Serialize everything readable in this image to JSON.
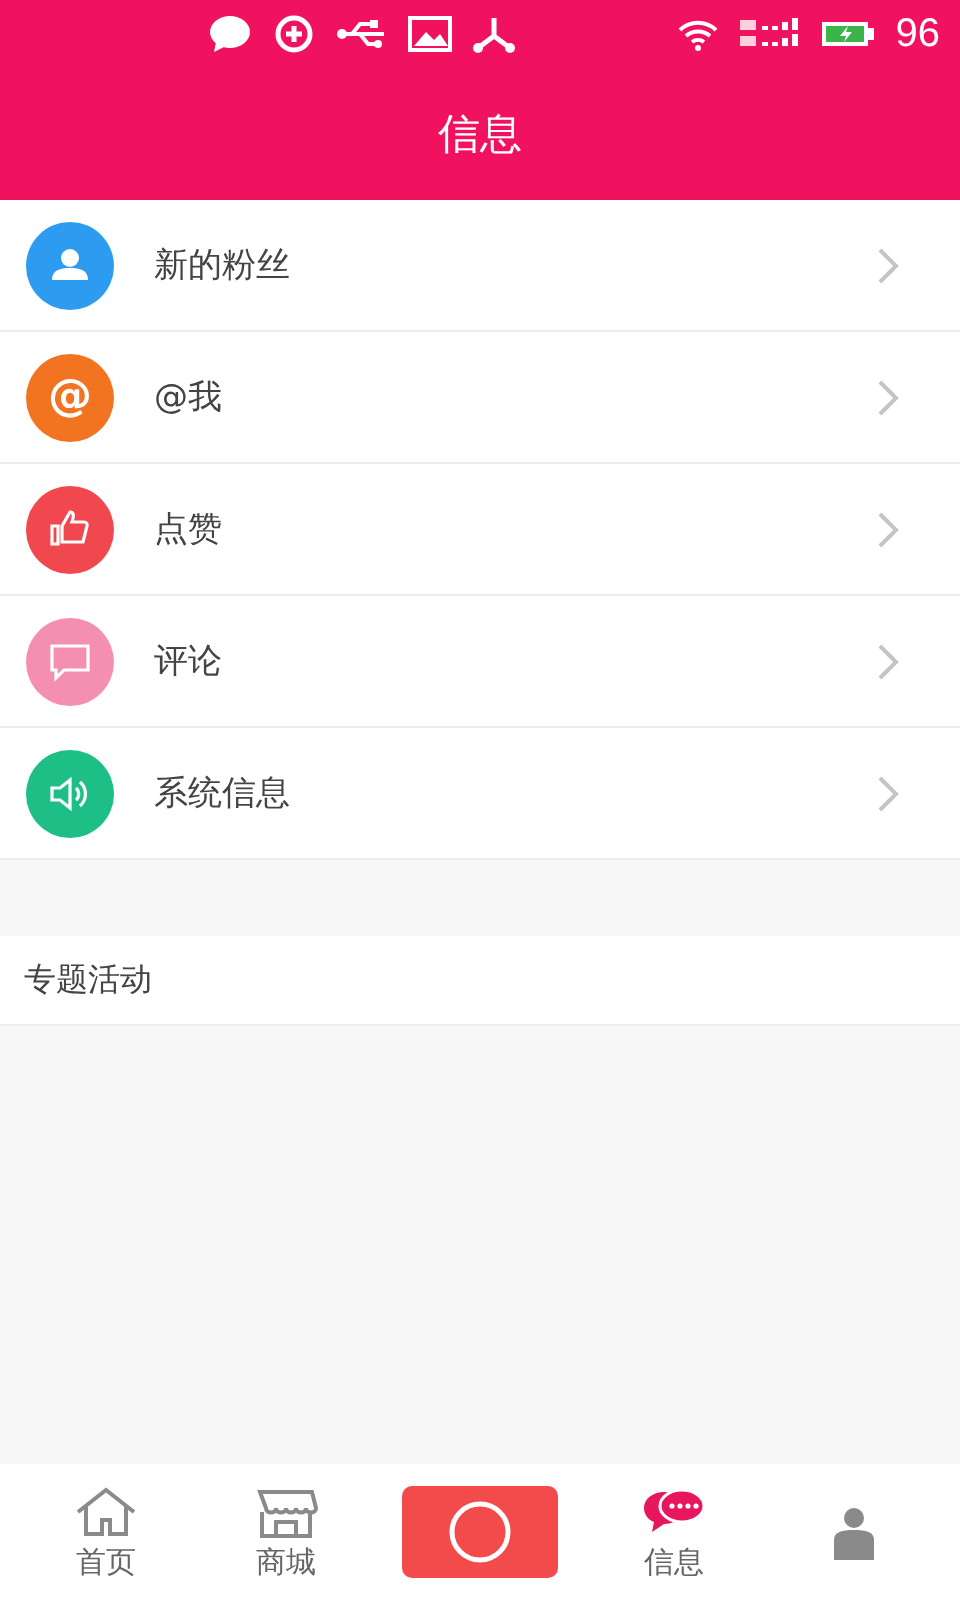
{
  "status_bar": {
    "battery_text": "96",
    "battery_charging": true
  },
  "header": {
    "title": "信息"
  },
  "menu": [
    {
      "kind": "user",
      "label": "新的粉丝",
      "color": "#2d9cf0"
    },
    {
      "kind": "at",
      "glyph": "@",
      "label": "@我",
      "color": "#f27421"
    },
    {
      "kind": "like",
      "label": "点赞",
      "color": "#f0484e"
    },
    {
      "kind": "comment",
      "label": "评论",
      "color": "#f48fb1"
    },
    {
      "kind": "system",
      "label": "系统信息",
      "color": "#1dbf87"
    }
  ],
  "section": {
    "title": "专题活动"
  },
  "nav": [
    {
      "kind": "home",
      "label": "首页",
      "selected": false
    },
    {
      "kind": "shop",
      "label": "商城",
      "selected": false
    },
    {
      "kind": "camera",
      "selected": false
    },
    {
      "kind": "message",
      "label": "信息",
      "selected": true
    },
    {
      "kind": "profile",
      "selected": false
    }
  ]
}
